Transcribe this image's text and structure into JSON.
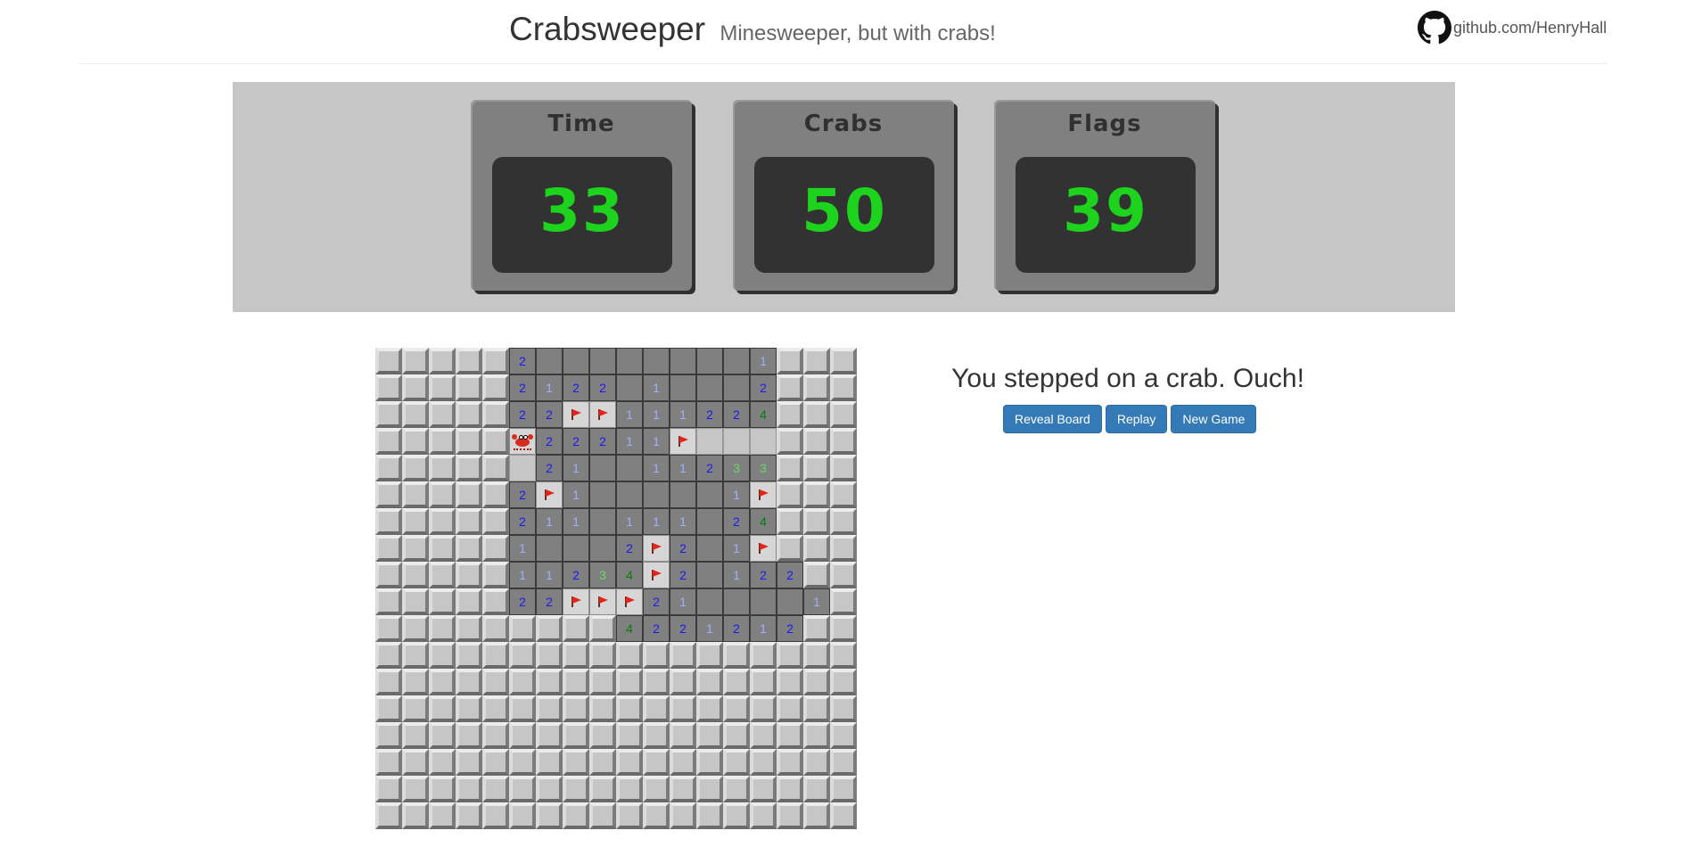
{
  "header": {
    "title": "Crabsweeper",
    "subtitle": "Minesweeper, but with crabs!",
    "github_link": "github.com/HenryHall",
    "github_icon": "github-icon"
  },
  "counters": [
    {
      "label": "Time",
      "value": "33"
    },
    {
      "label": "Crabs",
      "value": "50"
    },
    {
      "label": "Flags",
      "value": "39"
    }
  ],
  "status": {
    "message": "You stepped on a crab. Ouch!"
  },
  "actions": {
    "reveal_label": "Reveal Board",
    "replay_label": "Replay",
    "new_game_label": "New Game"
  },
  "colors": {
    "counter_digits": "#1dd31d",
    "button": "#337ab7",
    "num_1": "#9fb0ff",
    "num_2": "#1a1aee",
    "num_3": "#66d866",
    "num_4": "#0a7a0a"
  },
  "board": {
    "size": 18,
    "legend": "u = unrevealed, r = revealed empty, digit = revealed number, F = flagged, C = crab",
    "rows": [
      "uuuuu2rrrrrrrr1uuu",
      "uuuuu2122r1rrr2uuu",
      "uuuuu22FF11122 4uuu",
      "uuuuuC222 11Feeeuuu",
      "uuuuue21rr1123 3uuu",
      "uuuuu2F1rrrrr1Fuuu",
      "uuuuu211r111r24uuu",
      "uuuuu1rrr2F2r1Fuuu",
      "uuuuu11234F2r122uu",
      "uuuuu22FFF21rrrr1uu",
      "uuuuuuuuu4221212uu",
      "uuuuuuuuuuuuuuuuuu",
      "uuuuuuuuuuuuuuuuuu",
      "uuuuuuuuuuuuuuuuuu",
      "uuuuuuuuuuuuuuuuuu",
      "uuuuuuuuuuuuuuuuuu",
      "uuuuuuuuuuuuuuuuuu",
      "uuuuuuuuuuuuuuuuuu"
    ]
  }
}
